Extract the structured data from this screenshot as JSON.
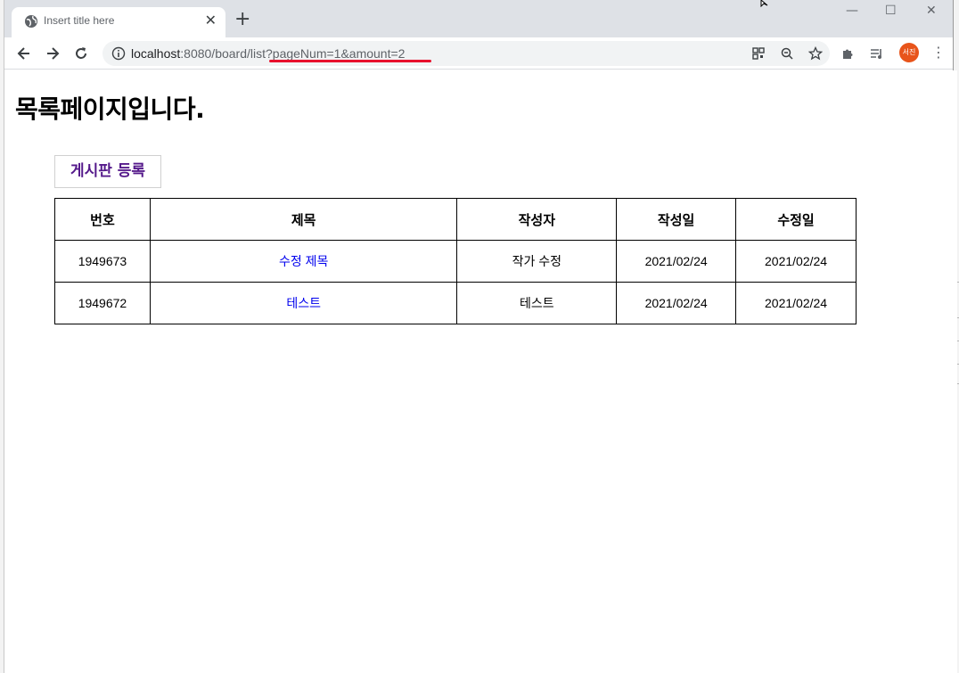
{
  "browser": {
    "tab_title": "Insert title here",
    "tab_close": "✕",
    "new_tab": "+",
    "window_controls": {
      "minimize": "—",
      "maximize": "☐",
      "close": "✕"
    },
    "url_host": "localhost",
    "url_path": ":8080/board/list?pageNum=1&amount=2",
    "profile_initials": "서진",
    "menu": "⋮",
    "accent_underline_color": "#e8112d",
    "profile_color": "#e8541a"
  },
  "page": {
    "title": "목록페이지입니다.",
    "register_button": "게시판 등록"
  },
  "table": {
    "headers": [
      "번호",
      "제목",
      "작성자",
      "작성일",
      "수정일"
    ],
    "rows": [
      {
        "no": "1949673",
        "title": "수정 제목",
        "writer": "작가 수정",
        "created": "2021/02/24",
        "updated": "2021/02/24"
      },
      {
        "no": "1949672",
        "title": "테스트",
        "writer": "테스트",
        "created": "2021/02/24",
        "updated": "2021/02/24"
      }
    ]
  }
}
